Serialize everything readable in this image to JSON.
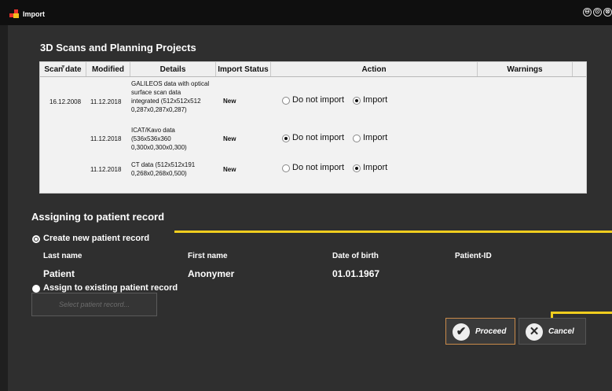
{
  "window": {
    "title": "Import",
    "buttons": [
      "⊖",
      "⊙",
      "⊗"
    ]
  },
  "scans": {
    "heading": "3D Scans and Planning Projects",
    "columns": [
      "Scan date",
      "Modified",
      "Details",
      "Import Status",
      "Action",
      "Warnings"
    ],
    "rows": [
      {
        "scan_date": "16.12.2008",
        "modified": "11.12.2018",
        "details": [
          "GALILEOS data with optical",
          "surface scan data",
          "integrated (512x512x512",
          "0,287x0,287x0,287)"
        ],
        "status": "New",
        "option_a": "Do not import",
        "option_b": "Import",
        "selected": "Import"
      },
      {
        "scan_date": "",
        "modified": "11.12.2018",
        "details": [
          "ICAT/Kavo data",
          "(536x536x360",
          "0,300x0,300x0,300)"
        ],
        "status": "New",
        "option_a": "Do not import",
        "option_b": "Import",
        "selected": "Do not import"
      },
      {
        "scan_date": "",
        "modified": "11.12.2018",
        "details": [
          "CT data (512x512x191",
          "0,268x0,268x0,500)"
        ],
        "status": "New",
        "option_a": "Do not import",
        "option_b": "Import",
        "selected": "Import"
      }
    ]
  },
  "assign": {
    "heading": "Assigning to patient record",
    "create_label": "Create new patient record",
    "create_selected": true,
    "existing_label": "Assign to existing patient record",
    "columns": [
      "Last name",
      "First name",
      "Date of birth",
      "Patient-ID"
    ],
    "patient": {
      "last_name": "Patient",
      "first_name": "Anonymer",
      "dob": "01.01.1967",
      "id": ""
    },
    "select_placeholder": "Select patient record..."
  },
  "actions": {
    "proceed": "Proceed",
    "cancel": "Cancel"
  },
  "colors": {
    "accent_yellow": "#f0cd1e",
    "proceed_border": "#c98a4a"
  }
}
